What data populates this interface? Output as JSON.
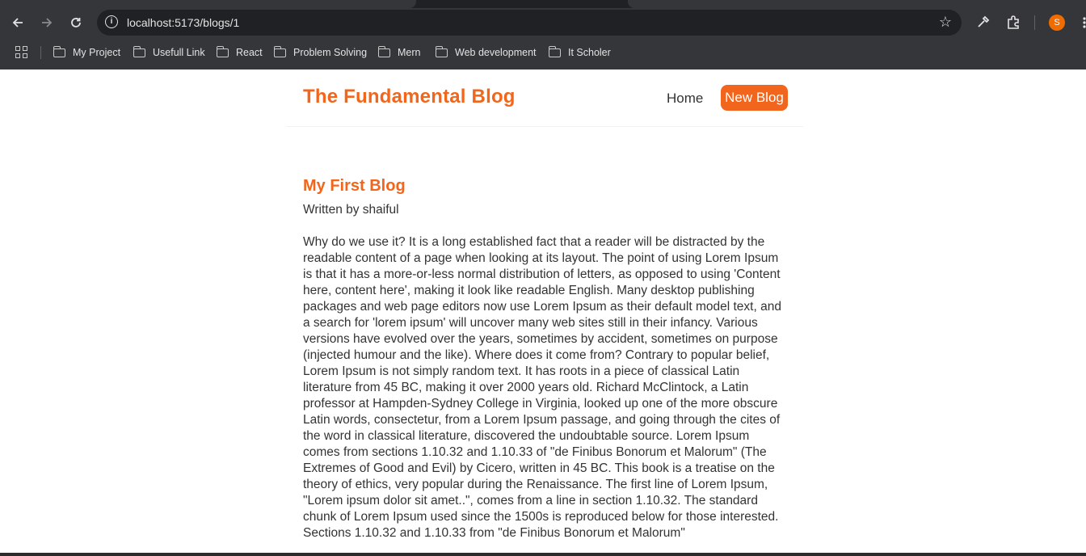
{
  "browser": {
    "url": "localhost:5173/blogs/1",
    "profile_initial": "S",
    "bookmarks": [
      {
        "label": "My Project"
      },
      {
        "label": "Usefull Link"
      },
      {
        "label": "React"
      },
      {
        "label": "Problem Solving"
      },
      {
        "label": "Mern"
      },
      {
        "label": "Web development"
      },
      {
        "label": "It Scholer"
      }
    ]
  },
  "site": {
    "title": "The Fundamental Blog",
    "nav": {
      "home": "Home",
      "new_blog": "New Blog"
    }
  },
  "blog": {
    "title": "My First Blog",
    "author": "Written by shaiful",
    "body": "Why do we use it? It is a long established fact that a reader will be distracted by the readable content of a page when looking at its layout. The point of using Lorem Ipsum is that it has a more-or-less normal distribution of letters, as opposed to using 'Content here, content here', making it look like readable English. Many desktop publishing packages and web page editors now use Lorem Ipsum as their default model text, and a search for 'lorem ipsum' will uncover many web sites still in their infancy. Various versions have evolved over the years, sometimes by accident, sometimes on purpose (injected humour and the like). Where does it come from? Contrary to popular belief, Lorem Ipsum is not simply random text. It has roots in a piece of classical Latin literature from 45 BC, making it over 2000 years old. Richard McClintock, a Latin professor at Hampden-Sydney College in Virginia, looked up one of the more obscure Latin words, consectetur, from a Lorem Ipsum passage, and going through the cites of the word in classical literature, discovered the undoubtable source. Lorem Ipsum comes from sections 1.10.32 and 1.10.33 of \"de Finibus Bonorum et Malorum\" (The Extremes of Good and Evil) by Cicero, written in 45 BC. This book is a treatise on the theory of ethics, very popular during the Renaissance. The first line of Lorem Ipsum, \"Lorem ipsum dolor sit amet..\", comes from a line in section 1.10.32. The standard chunk of Lorem Ipsum used since the 1500s is reproduced below for those interested. Sections 1.10.32 and 1.10.33 from \"de Finibus Bonorum et Malorum\""
  },
  "colors": {
    "accent": "#f1661c",
    "text": "#333333",
    "chrome_bg": "#35363a",
    "omnibox_bg": "#202124"
  },
  "icons": [
    "back-arrow-icon",
    "forward-arrow-icon",
    "reload-icon",
    "site-info-icon",
    "star-icon",
    "eyedropper-icon",
    "extensions-icon",
    "apps-grid-icon",
    "folder-icon"
  ]
}
